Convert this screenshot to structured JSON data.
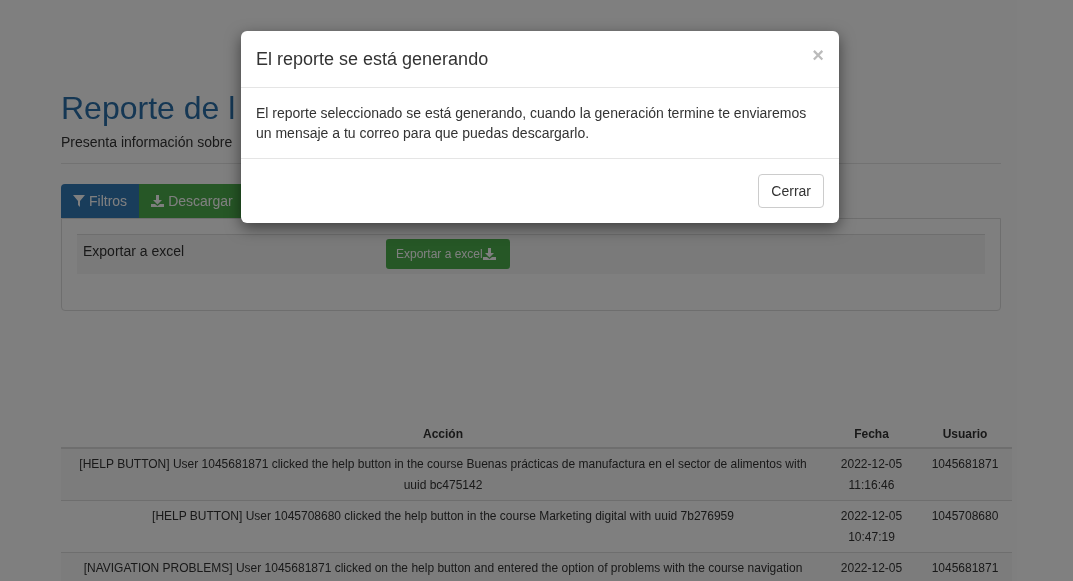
{
  "page": {
    "title": "Reporte de l",
    "subtitle": "Presenta información sobre"
  },
  "tabs": [
    {
      "label": "Filtros",
      "kind": "filter",
      "selected": true
    },
    {
      "label": "Descargar",
      "kind": "download",
      "selected": false
    }
  ],
  "export_panel": {
    "label": "Exportar a excel",
    "button": "Exportar a excel"
  },
  "table": {
    "columns": [
      "Acción",
      "Fecha",
      "Usuario"
    ],
    "rows": [
      {
        "accion": "[HELP BUTTON] User 1045681871 clicked the help button in the course Buenas prácticas de manufactura en el sector de alimentos with uuid bc475142",
        "fecha": [
          "2022-12-05",
          "11:16:46"
        ],
        "usuario": "1045681871"
      },
      {
        "accion": "[HELP BUTTON] User 1045708680 clicked the help button in the course Marketing digital with uuid 7b276959",
        "fecha": [
          "2022-12-05",
          "10:47:19"
        ],
        "usuario": "1045708680"
      },
      {
        "accion": "[NAVIGATION PROBLEMS] User 1045681871 clicked on the help button and entered the option of problems with the course navigation",
        "fecha": [
          "2022-12-05"
        ],
        "usuario": "1045681871"
      }
    ]
  },
  "modal": {
    "title": "El reporte se está generando",
    "close": "×",
    "body": "El reporte seleccionado se está generando, cuando la generación termine te enviaremos un mensaje a tu correo para que puedas descargarlo.",
    "button": "Cerrar"
  }
}
